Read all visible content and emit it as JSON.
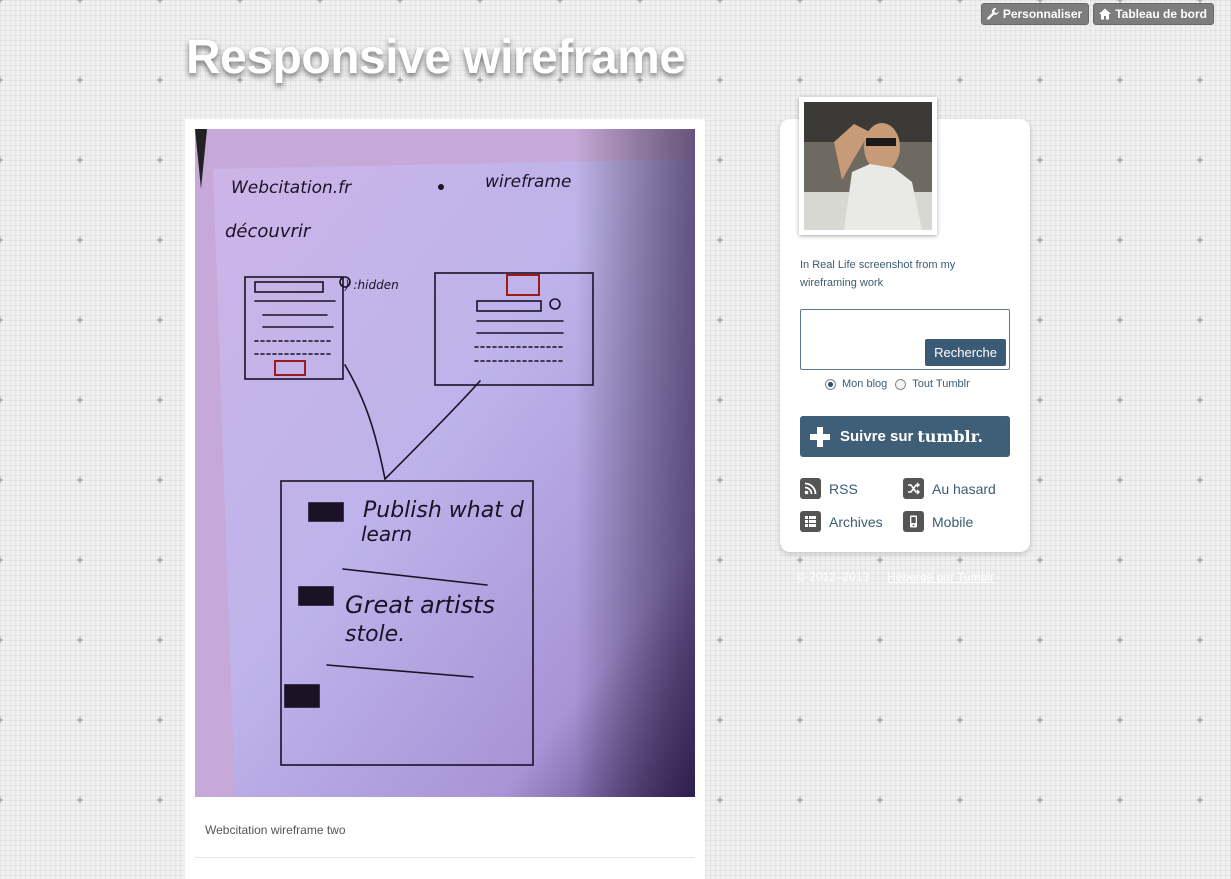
{
  "controls": {
    "customize_label": "Personnaliser",
    "dashboard_label": "Tableau de bord"
  },
  "blog": {
    "title": "Responsive wireframe"
  },
  "post": {
    "caption": "Webcitation wireframe two",
    "sketch": {
      "site_label": "Webcitation.fr",
      "wireframe_label": "wireframe",
      "discover_label": "découvrir",
      "hidden_label": ") :hidden",
      "text1_a": "Publish what d",
      "text1_b": "learn",
      "text2_a": "Great artists",
      "text2_b": "stole."
    }
  },
  "sidebar": {
    "description": "In Real Life screenshot from my wireframing work",
    "search": {
      "placeholder": "",
      "button_label": "Recherche",
      "options": [
        "Mon blog",
        "Tout Tumblr"
      ],
      "selected": "Mon blog"
    },
    "follow": {
      "label": "Suivre sur",
      "brand": "tumblr."
    },
    "links": {
      "rss": "RSS",
      "random": "Au hasard",
      "archives": "Archives",
      "mobile": "Mobile"
    }
  },
  "footer": {
    "copyright": "© 2012–2013",
    "powered": "Hébergé par Tumblr"
  },
  "colors": {
    "accent": "#3f5e77",
    "sidebar_text": "#3b5c73",
    "sketch_paper": "#b9a8e0"
  }
}
